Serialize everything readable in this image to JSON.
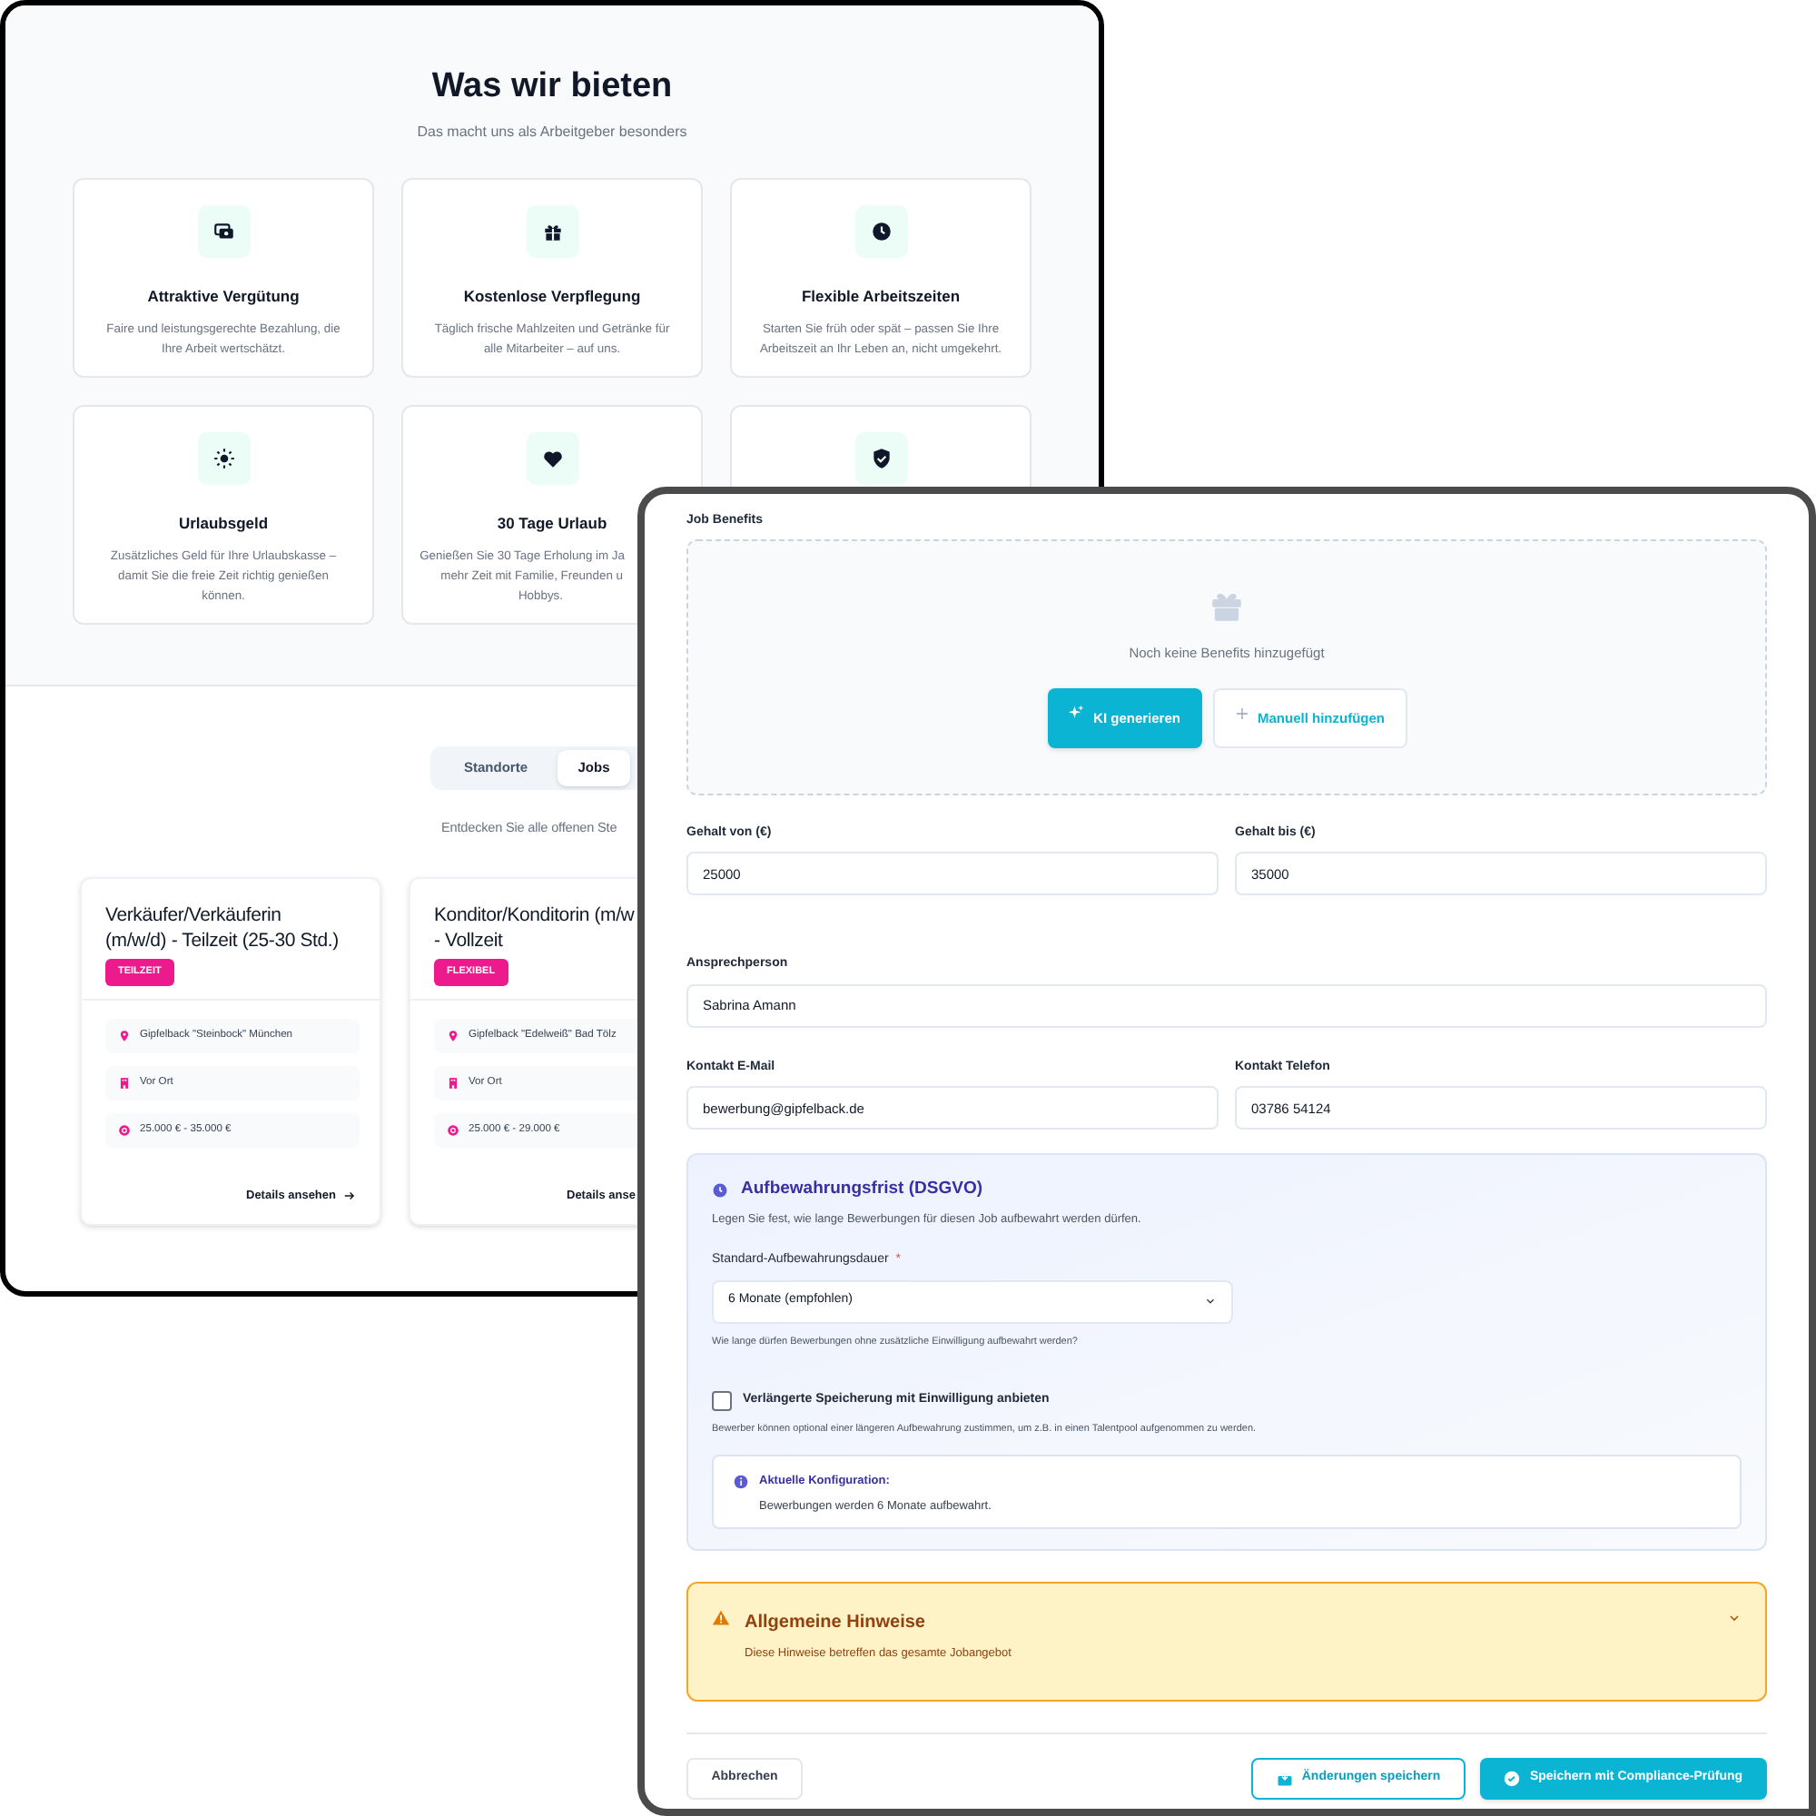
{
  "benefits_page": {
    "title": "Was wir bieten",
    "subtitle": "Das macht uns als Arbeitgeber besonders",
    "benefits": [
      {
        "kind": "full",
        "title": "Attraktive Vergütung",
        "description_lines": [
          "Faire und leistungsgerechte Bezahlung, die",
          "Ihre Arbeit wertschätzt."
        ]
      },
      {
        "kind": "full",
        "title": "Kostenlose Verpflegung",
        "description_lines": [
          "Täglich frische Mahlzeiten und Getränke für",
          "alle Mitarbeiter – auf uns."
        ]
      },
      {
        "kind": "full",
        "title": "Flexible Arbeitszeiten",
        "description_lines": [
          "Starten Sie früh oder spät – passen Sie Ihre",
          "Arbeitszeit an Ihr Leben an, nicht umgekehrt."
        ]
      },
      {
        "kind": "full",
        "title": "Urlaubsgeld",
        "description_lines": [
          "Zusätzliches Geld für Ihre Urlaubskasse –",
          "damit Sie die freie Zeit richtig genießen",
          "können."
        ]
      },
      {
        "kind": "cut",
        "title": "30 Tage Urlaub",
        "description_lines": [
          "Genießen Sie 30 Tage Erholung im Ja",
          "mehr Zeit mit Familie, Freunden u",
          "Hobbys."
        ]
      },
      {
        "kind": "icon_only"
      }
    ],
    "tabs": [
      {
        "label": "Standorte",
        "selected": false
      },
      {
        "label": "Jobs",
        "selected": true
      }
    ],
    "jobs_intro": "Entdecken Sie alle offenen Ste",
    "jobs": [
      {
        "title_lines": [
          "Verkäufer/Verkäuferin",
          "(m/w/d) - Teilzeit (25-30 Std.)"
        ],
        "tag": "TEILZEIT",
        "details": [
          {
            "kind": "location",
            "text": "Gipfelback \"Steinbock\" München"
          },
          {
            "kind": "mode",
            "text": "Vor Ort"
          },
          {
            "kind": "salary",
            "text": "25.000 € - 35.000 €"
          }
        ],
        "link": "Details ansehen",
        "link_arrow": true
      },
      {
        "title_lines": [
          "Konditor/Konditorin (m/w",
          "- Vollzeit"
        ],
        "tag": "FLEXIBEL",
        "details": [
          {
            "kind": "location",
            "text": "Gipfelback \"Edelweiß\" Bad Tölz"
          },
          {
            "kind": "mode",
            "text": "Vor Ort"
          },
          {
            "kind": "salary",
            "text": "25.000 € - 29.000 €"
          }
        ],
        "link": "Details anse",
        "link_arrow": false
      }
    ]
  },
  "job_form": {
    "benefits": {
      "label": "Job Benefits",
      "empty_text": "Noch keine Benefits hinzugefügt",
      "buttons": [
        {
          "label": "KI generieren",
          "kind": "primary"
        },
        {
          "label": "Manuell hinzufügen",
          "kind": "secondary"
        }
      ]
    },
    "field_rows": [
      [
        {
          "label": "Gehalt von (€)",
          "value": "25000"
        },
        {
          "label": "Gehalt bis (€)",
          "value": "35000"
        }
      ],
      [
        {
          "label": "Ansprechperson",
          "value": "Sabrina Amann"
        }
      ],
      [
        {
          "label": "Kontakt E-Mail",
          "value": "bewerbung@gipfelback.de"
        },
        {
          "label": "Kontakt Telefon",
          "value": "03786 54124"
        }
      ]
    ],
    "retention": {
      "title": "Aufbewahrungsfrist (DSGVO)",
      "description": "Legen Sie fest, wie lange Bewerbungen für diesen Job aufbewahrt werden dürfen.",
      "select_label": "Standard-Aufbewahrungsdauer",
      "required_mark": "*",
      "select_value": "6 Monate (empfohlen)",
      "select_hint": "Wie lange dürfen Bewerbungen ohne zusätzliche Einwilligung aufbewahrt werden?",
      "checkbox_label": "Verlängerte Speicherung mit Einwilligung anbieten",
      "checked": false,
      "checkbox_hint": "Bewerber können optional einer längeren Aufbewahrung zustimmen, um z.B. in einen Talentpool aufgenommen zu werden.",
      "info_title": "Aktuelle Konfiguration:",
      "info_text": "Bewerbungen werden 6 Monate aufbewahrt."
    },
    "notice": {
      "title": "Allgemeine Hinweise",
      "text": "Diese Hinweise betreffen das gesamte Jobangebot",
      "expanded": false
    },
    "footer_buttons": [
      {
        "label": "Abbrechen",
        "kind": "cancel"
      },
      {
        "label": "Änderungen speichern",
        "kind": "outline"
      },
      {
        "label": "Speichern mit Compliance-Prüfung",
        "kind": "primary"
      }
    ]
  }
}
